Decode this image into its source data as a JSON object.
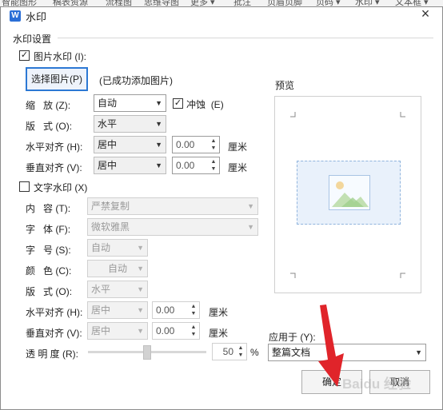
{
  "ribbon": [
    "智能图形",
    "稿表资源",
    "流程图",
    "思维导图",
    "更多 ▾",
    "批注",
    "页眉页脚",
    "页码 ▾",
    "水印 ▾",
    "文本框 ▾"
  ],
  "dialog": {
    "title": "水印",
    "close_icon": "×",
    "group_title": "水印设置",
    "preview_label": "预览"
  },
  "picture": {
    "checkbox_label": "图片水印",
    "checkbox_key": "(I):",
    "checked": true,
    "select_button": "选择图片",
    "select_button_key": "(P)",
    "status": "(已成功添加图片)",
    "scale_label": "缩",
    "scale_label2": "放",
    "scale_key": "(Z):",
    "scale_value": "自动",
    "washout_label": "冲蚀",
    "washout_key": "(E)",
    "washout_checked": true,
    "layout_label": "版",
    "layout_label2": "式",
    "layout_key": "(O):",
    "layout_value": "水平",
    "halign_label": "水平对齐",
    "halign_key": "(H):",
    "halign_value": "居中",
    "halign_offset": "0.00",
    "valign_label": "垂直对齐",
    "valign_key": "(V):",
    "valign_value": "居中",
    "valign_offset": "0.00",
    "unit": "厘米"
  },
  "text": {
    "checkbox_label": "文字水印",
    "checkbox_key": "(X)",
    "checked": false,
    "content_label": "内",
    "content_label2": "容",
    "content_key": "(T):",
    "content_value": "严禁复制",
    "font_label": "字",
    "font_label2": "体",
    "font_key": "(F):",
    "font_value": "微软雅黑",
    "size_label": "字",
    "size_label2": "号",
    "size_key": "(S):",
    "size_value": "自动",
    "color_label": "颜",
    "color_label2": "色",
    "color_key": "(C):",
    "color_value": "自动",
    "layout_label": "版",
    "layout_label2": "式",
    "layout_key": "(O):",
    "layout_value": "水平",
    "halign_label": "水平对齐",
    "halign_key": "(H):",
    "halign_value": "居中",
    "halign_offset": "0.00",
    "valign_label": "垂直对齐",
    "valign_key": "(V):",
    "valign_value": "居中",
    "valign_offset": "0.00",
    "unit": "厘米",
    "opacity_label": "透 明 度",
    "opacity_key": "(R):",
    "opacity_value": "50",
    "opacity_unit": "%"
  },
  "apply": {
    "label": "应用于",
    "key": "(Y):",
    "value": "整篇文档"
  },
  "footer": {
    "ok": "确定",
    "cancel": "取消"
  },
  "watermark_text": "Baidu 经验",
  "colors": {
    "accent": "#2c78d4",
    "arrow": "#e0242a"
  }
}
